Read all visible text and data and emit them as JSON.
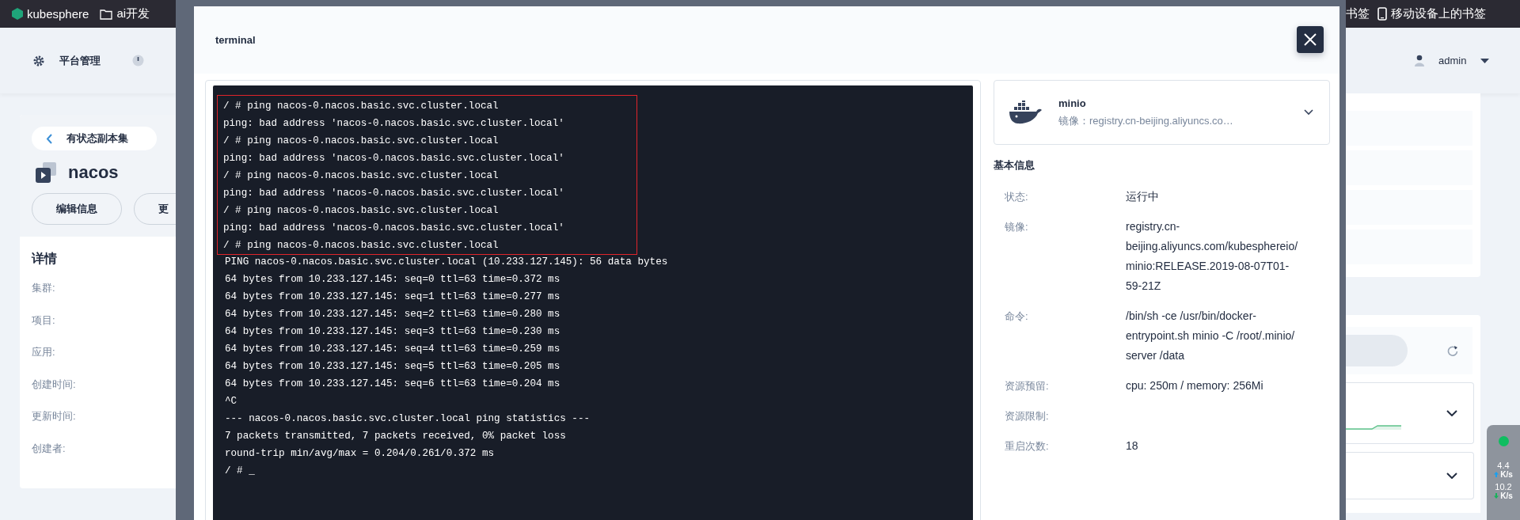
{
  "bookmarks": {
    "left": [
      {
        "kind": "site",
        "label": "kubesphere"
      },
      {
        "kind": "folder",
        "label": "ai开发"
      }
    ],
    "right": [
      {
        "kind": "plain",
        "label": "书签"
      },
      {
        "kind": "mobile",
        "label": "移动设备上的书签"
      }
    ]
  },
  "top_nav": {
    "item": "平台管理",
    "user": "admin"
  },
  "detail_card": {
    "back_label": "有状态副本集",
    "name": "nacos",
    "buttons": [
      "编辑信息",
      "更"
    ],
    "section_title": "详情",
    "fields": [
      "集群:",
      "项目:",
      "应用:",
      "创建时间:",
      "更新时间:",
      "创建者:"
    ]
  },
  "modal": {
    "title": "terminal",
    "terminal_lines": [
      {
        "text": "/ # ping nacos-0.nacos.basic.svc.cluster.local",
        "highlighted": true
      },
      {
        "text": "ping: bad address 'nacos-0.nacos.basic.svc.cluster.local'",
        "highlighted": true
      },
      {
        "text": "/ # ping nacos-0.nacos.basic.svc.cluster.local",
        "highlighted": true
      },
      {
        "text": "ping: bad address 'nacos-0.nacos.basic.svc.cluster.local'",
        "highlighted": true
      },
      {
        "text": "/ # ping nacos-0.nacos.basic.svc.cluster.local",
        "highlighted": true
      },
      {
        "text": "ping: bad address 'nacos-0.nacos.basic.svc.cluster.local'",
        "highlighted": true
      },
      {
        "text": "/ # ping nacos-0.nacos.basic.svc.cluster.local",
        "highlighted": true
      },
      {
        "text": "ping: bad address 'nacos-0.nacos.basic.svc.cluster.local'",
        "highlighted": true
      },
      {
        "text": "/ # ping nacos-0.nacos.basic.svc.cluster.local",
        "highlighted": true
      },
      {
        "text": "PING nacos-0.nacos.basic.svc.cluster.local (10.233.127.145): 56 data bytes",
        "highlighted": false
      },
      {
        "text": "64 bytes from 10.233.127.145: seq=0 ttl=63 time=0.372 ms",
        "highlighted": false
      },
      {
        "text": "64 bytes from 10.233.127.145: seq=1 ttl=63 time=0.277 ms",
        "highlighted": false
      },
      {
        "text": "64 bytes from 10.233.127.145: seq=2 ttl=63 time=0.280 ms",
        "highlighted": false
      },
      {
        "text": "64 bytes from 10.233.127.145: seq=3 ttl=63 time=0.230 ms",
        "highlighted": false
      },
      {
        "text": "64 bytes from 10.233.127.145: seq=4 ttl=63 time=0.259 ms",
        "highlighted": false
      },
      {
        "text": "64 bytes from 10.233.127.145: seq=5 ttl=63 time=0.205 ms",
        "highlighted": false
      },
      {
        "text": "64 bytes from 10.233.127.145: seq=6 ttl=63 time=0.204 ms",
        "highlighted": false
      },
      {
        "text": "^C",
        "highlighted": false
      },
      {
        "text": "--- nacos-0.nacos.basic.svc.cluster.local ping statistics ---",
        "highlighted": false
      },
      {
        "text": "7 packets transmitted, 7 packets received, 0% packet loss",
        "highlighted": false
      },
      {
        "text": "round-trip min/avg/max = 0.204/0.261/0.372 ms",
        "highlighted": false
      },
      {
        "text": "/ # _",
        "highlighted": false
      }
    ],
    "container": {
      "name": "minio",
      "image_label": "镜像：",
      "image": "registry.cn-beijing.aliyuncs.co…"
    },
    "info_title": "基本信息",
    "info": [
      {
        "label": "状态:",
        "value": "运行中"
      },
      {
        "label": "镜像:",
        "value": "registry.cn-beijing.aliyuncs.com/kubesphereio/minio:RELEASE.2019-08-07T01-59-21Z"
      },
      {
        "label": "命令:",
        "value": "/bin/sh -ce /usr/bin/docker-entrypoint.sh minio -C /root/.minio/ server /data"
      },
      {
        "label": "资源预留:",
        "value": "cpu: 250m / memory: 256Mi"
      },
      {
        "label": "资源限制:"
      },
      {
        "label": "重启次数:",
        "value": "18"
      }
    ]
  },
  "network_widget": {
    "upload": "4.4",
    "upload_unit": "K/s",
    "download": "10.2",
    "download_unit": "K/s"
  }
}
